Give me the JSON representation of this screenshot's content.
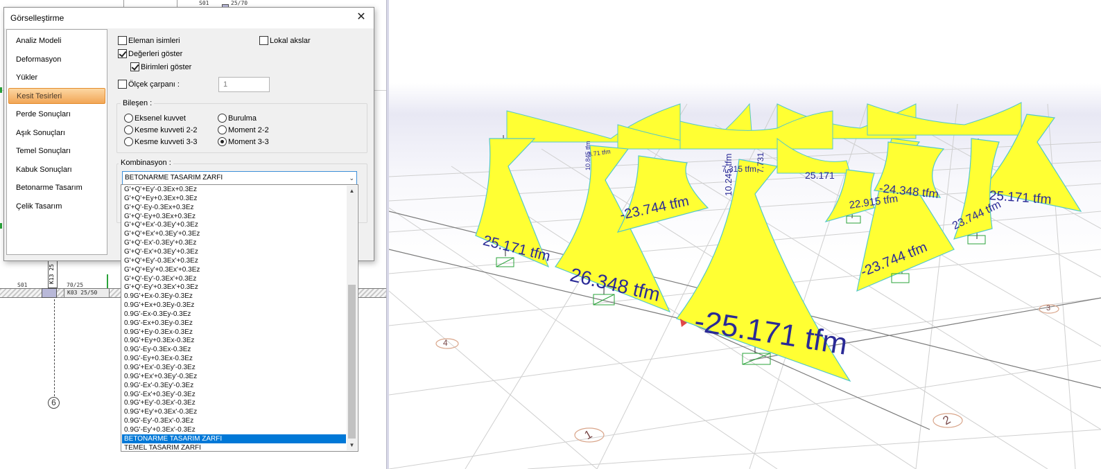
{
  "dialog": {
    "title": "Görselleştirme",
    "close_glyph": "✕"
  },
  "nav": {
    "items": [
      {
        "label": "Analiz Modeli",
        "selected": false
      },
      {
        "label": "Deformasyon",
        "selected": false
      },
      {
        "label": "Yükler",
        "selected": false
      },
      {
        "label": "Kesit Tesirleri",
        "selected": true
      },
      {
        "label": "Perde Sonuçları",
        "selected": false
      },
      {
        "label": "Aşık Sonuçları",
        "selected": false
      },
      {
        "label": "Temel Sonuçları",
        "selected": false
      },
      {
        "label": "Kabuk Sonuçları",
        "selected": false
      },
      {
        "label": "Betonarme Tasarım",
        "selected": false
      },
      {
        "label": "Çelik Tasarım",
        "selected": false
      }
    ]
  },
  "options": {
    "element_names": {
      "label": "Eleman isimleri",
      "checked": false
    },
    "local_axes": {
      "label": "Lokal akslar",
      "checked": false
    },
    "show_values": {
      "label": "Değerleri göster",
      "checked": true
    },
    "show_units": {
      "label": "Birimleri göster",
      "checked": true
    },
    "scale_factor": {
      "label": "Ölçek çarpanı :",
      "checked": false,
      "value": "1"
    }
  },
  "component": {
    "title": "Bileşen :",
    "options": [
      {
        "label": "Eksenel kuvvet",
        "checked": false
      },
      {
        "label": "Kesme kuvveti 2-2",
        "checked": false
      },
      {
        "label": "Kesme kuvveti 3-3",
        "checked": false
      },
      {
        "label": "Burulma",
        "checked": false
      },
      {
        "label": "Moment 2-2",
        "checked": false
      },
      {
        "label": "Moment 3-3",
        "checked": true
      }
    ]
  },
  "combination": {
    "title": "Kombinasyon :",
    "selected": "BETONARME TASARIM ZARFI",
    "items": [
      "G'+Q'+Ey'-0.3Ex+0.3Ez",
      "G'+Q'+Ey+0.3Ex+0.3Ez",
      "G'+Q'-Ey-0.3Ex+0.3Ez",
      "G'+Q'-Ey+0.3Ex+0.3Ez",
      "G'+Q'+Ex'-0.3Ey'+0.3Ez",
      "G'+Q'+Ex'+0.3Ey'+0.3Ez",
      "G'+Q'-Ex'-0.3Ey'+0.3Ez",
      "G'+Q'-Ex'+0.3Ey'+0.3Ez",
      "G'+Q'+Ey'-0.3Ex'+0.3Ez",
      "G'+Q'+Ey'+0.3Ex'+0.3Ez",
      "G'+Q'-Ey'-0.3Ex'+0.3Ez",
      "G'+Q'-Ey'+0.3Ex'+0.3Ez",
      "0.9G'+Ex-0.3Ey-0.3Ez",
      "0.9G'+Ex+0.3Ey-0.3Ez",
      "0.9G'-Ex-0.3Ey-0.3Ez",
      "0.9G'-Ex+0.3Ey-0.3Ez",
      "0.9G'+Ey-0.3Ex-0.3Ez",
      "0.9G'+Ey+0.3Ex-0.3Ez",
      "0.9G'-Ey-0.3Ex-0.3Ez",
      "0.9G'-Ey+0.3Ex-0.3Ez",
      "0.9G'+Ex'-0.3Ey'-0.3Ez",
      "0.9G'+Ex'+0.3Ey'-0.3Ez",
      "0.9G'-Ex'-0.3Ey'-0.3Ez",
      "0.9G'-Ex'+0.3Ey'-0.3Ez",
      "0.9G'+Ey'-0.3Ex'-0.3Ez",
      "0.9G'+Ey'+0.3Ex'-0.3Ez",
      "0.9G'-Ey'-0.3Ex'-0.3Ez",
      "0.9G'-Ey'+0.3Ex'-0.3Ez",
      "BETONARME TASARIM ZARFI",
      "TEMEL TASARIM ZARFI"
    ],
    "scroll_up_glyph": "▲",
    "scroll_down_glyph": "▼",
    "combo_arrow_glyph": "⌄"
  },
  "plan": {
    "labels": {
      "top_s01": "S01",
      "top_dim": "25/70",
      "s01": "S01",
      "dim_7025": "70/25",
      "beam": "K03 25/50",
      "column": "K13 25",
      "axis": "6"
    }
  },
  "viewport": {
    "colors": {
      "diagram_fill": "#ffff33",
      "diagram_edge": "#54c8c8",
      "label": "#2a2a96",
      "grid": "#c9c9c9"
    },
    "moment_labels": [
      "-25.171 tfm",
      "26.348 tfm",
      "25.171 tfm",
      "-23.744 tfm",
      "-23.744 tfm",
      "23.744 tfm",
      "25.171 tfm",
      "22.915 tfm",
      "-24.348 tfm",
      "25.171",
      "7.315 tfm",
      "10.245 tfm",
      "7.731",
      "8.71 tfm",
      "10.845 tfm"
    ],
    "axis_labels": [
      "1",
      "2",
      "3",
      "4"
    ]
  }
}
